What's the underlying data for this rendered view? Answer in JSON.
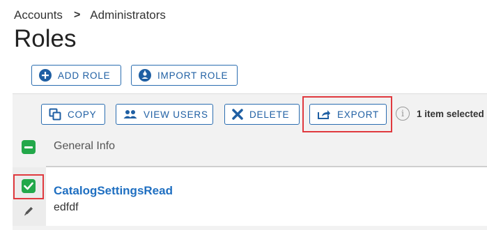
{
  "breadcrumb": {
    "items": [
      "Accounts",
      "Administrators"
    ],
    "separator": ">"
  },
  "page": {
    "title": "Roles"
  },
  "actions": {
    "add_role": {
      "label": "ADD ROLE",
      "icon": "plus-circle-icon"
    },
    "import_role": {
      "label": "IMPORT ROLE",
      "icon": "import-user-icon"
    }
  },
  "toolbar": {
    "copy": {
      "label": "COPY",
      "icon": "copy-icon"
    },
    "view_users": {
      "label": "VIEW USERS",
      "icon": "users-icon"
    },
    "delete": {
      "label": "DELETE",
      "icon": "x-icon"
    },
    "export": {
      "label": "EXPORT",
      "icon": "export-icon"
    },
    "selected_text": "1 item selected"
  },
  "table": {
    "column_header": "General Info",
    "rows": [
      {
        "name": "CatalogSettingsRead",
        "description": "edfdf",
        "checked": true
      }
    ]
  },
  "colors": {
    "accent": "#1f5fa3",
    "checkbox_green": "#23a84a",
    "highlight_red": "#e0393e",
    "link_blue": "#1f6fc1"
  }
}
